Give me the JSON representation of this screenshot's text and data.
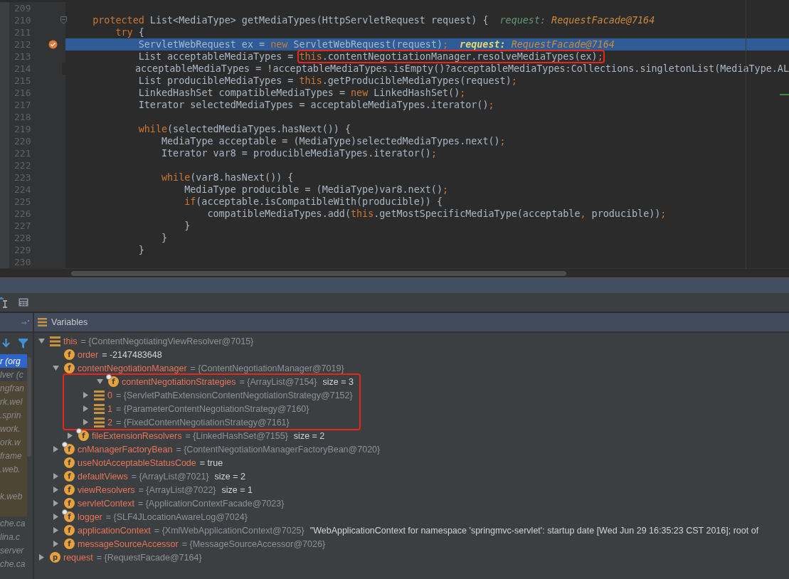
{
  "editor": {
    "lines": [
      {
        "number": "209"
      },
      {
        "number": "210",
        "foldable": true,
        "tokens": [
          {
            "kind": "keyword",
            "text": "protected"
          },
          {
            "kind": "plain",
            "text": " List<MediaType> getMediaTypes(HttpServletRequest request) {"
          }
        ],
        "hint": {
          "label": "request:",
          "value": "RequestFacade@7164"
        },
        "children": [
          {
            "number": "211",
            "tokens": [
              {
                "kind": "keyword",
                "text": "try"
              },
              {
                "kind": "plain",
                "text": " {"
              }
            ],
            "children": [
              {
                "number": "212",
                "selected": true,
                "breakpoint": true,
                "tokens": [
                  {
                    "kind": "plain",
                    "text": "ServletWebRequest ex = "
                  },
                  {
                    "kind": "keyword",
                    "text": "new"
                  },
                  {
                    "kind": "plain",
                    "text": " ServletWebRequest(request)"
                  },
                  {
                    "kind": "punct",
                    "text": ";"
                  }
                ],
                "hint": {
                  "label": "request:",
                  "value": "RequestFacade@7164"
                }
              },
              {
                "number": "213",
                "tokens": [
                  {
                    "kind": "plain",
                    "text": "List acceptableMediaTypes = "
                  },
                  {
                    "kind": "keyword",
                    "text": "this",
                    "boxed": true
                  },
                  {
                    "kind": "plain",
                    "text": ".contentNegotiationManager.resolveMediaTypes(ex)",
                    "boxed": true
                  },
                  {
                    "kind": "punct",
                    "text": ";",
                    "boxed": true
                  }
                ]
              },
              {
                "number": "214",
                "tokens": [
                  {
                    "kind": "plain",
                    "text": "acceptableMediaTypes = !acceptableMediaTypes.isEmpty()?acceptableMediaTypes:Collections.singletonList(MediaType.AL"
                  }
                ]
              },
              {
                "number": "215",
                "tokens": [
                  {
                    "kind": "plain",
                    "text": "List producibleMediaTypes = "
                  },
                  {
                    "kind": "keyword",
                    "text": "this"
                  },
                  {
                    "kind": "plain",
                    "text": ".getProducibleMediaTypes(request)"
                  },
                  {
                    "kind": "punct",
                    "text": ";"
                  }
                ]
              },
              {
                "number": "216",
                "tokens": [
                  {
                    "kind": "plain",
                    "text": "LinkedHashSet compatibleMediaTypes = "
                  },
                  {
                    "kind": "keyword",
                    "text": "new"
                  },
                  {
                    "kind": "plain",
                    "text": " LinkedHashSet()"
                  },
                  {
                    "kind": "punct",
                    "text": ";"
                  }
                ]
              },
              {
                "number": "217",
                "tokens": [
                  {
                    "kind": "plain",
                    "text": "Iterator selectedMediaTypes = acceptableMediaTypes.iterator()"
                  },
                  {
                    "kind": "punct",
                    "text": ";"
                  }
                ]
              },
              {
                "number": "218"
              },
              {
                "number": "219",
                "tokens": [
                  {
                    "kind": "keyword",
                    "text": "while"
                  },
                  {
                    "kind": "plain",
                    "text": "(selectedMediaTypes.hasNext()) {"
                  }
                ],
                "children": [
                  {
                    "number": "220",
                    "tokens": [
                      {
                        "kind": "plain",
                        "text": "MediaType acceptable = (MediaType)selectedMediaTypes.next()"
                      },
                      {
                        "kind": "punct",
                        "text": ";"
                      }
                    ]
                  },
                  {
                    "number": "221",
                    "tokens": [
                      {
                        "kind": "plain",
                        "text": "Iterator var8 = producibleMediaTypes.iterator()"
                      },
                      {
                        "kind": "punct",
                        "text": ";"
                      }
                    ]
                  },
                  {
                    "number": "222"
                  },
                  {
                    "number": "223",
                    "tokens": [
                      {
                        "kind": "keyword",
                        "text": "while"
                      },
                      {
                        "kind": "plain",
                        "text": "(var8.hasNext()) {"
                      }
                    ],
                    "children": [
                      {
                        "number": "224",
                        "tokens": [
                          {
                            "kind": "plain",
                            "text": "MediaType producible = (MediaType)var8.next()"
                          },
                          {
                            "kind": "punct",
                            "text": ";"
                          }
                        ]
                      },
                      {
                        "number": "225",
                        "tokens": [
                          {
                            "kind": "keyword",
                            "text": "if"
                          },
                          {
                            "kind": "plain",
                            "text": "(acceptable.isCompatibleWith(producible)) {"
                          }
                        ],
                        "children": [
                          {
                            "number": "226",
                            "tokens": [
                              {
                                "kind": "plain",
                                "text": "compatibleMediaTypes.add("
                              },
                              {
                                "kind": "keyword",
                                "text": "this"
                              },
                              {
                                "kind": "plain",
                                "text": ".getMostSpecificMediaType(acceptable"
                              },
                              {
                                "kind": "punct",
                                "text": ","
                              },
                              {
                                "kind": "plain",
                                "text": " producible))"
                              },
                              {
                                "kind": "punct",
                                "text": ";"
                              }
                            ]
                          }
                        ]
                      },
                      {
                        "number": "227",
                        "tokens": [
                          {
                            "kind": "plain",
                            "text": "}"
                          }
                        ]
                      }
                    ]
                  },
                  {
                    "number": "228",
                    "tokens": [
                      {
                        "kind": "plain",
                        "text": "}"
                      }
                    ]
                  }
                ]
              },
              {
                "number": "229",
                "tokens": [
                  {
                    "kind": "plain",
                    "text": "}"
                  }
                ]
              },
              {
                "number": "230"
              }
            ]
          }
        ]
      }
    ]
  },
  "frames": {
    "items": [
      {
        "label": "r (org",
        "selected": true,
        "library": false
      },
      {
        "label": "lver (c",
        "selected": false,
        "library": false
      },
      {
        "label": "ngfran",
        "selected": false,
        "library": true
      },
      {
        "label": "rk.wel",
        "selected": false,
        "library": true
      },
      {
        "label": ".sprin",
        "selected": false,
        "library": true
      },
      {
        "label": "work.",
        "selected": false,
        "library": true
      },
      {
        "label": "ork.w",
        "selected": false,
        "library": true
      },
      {
        "label": "frame",
        "selected": false,
        "library": true
      },
      {
        "label": ".web.",
        "selected": false,
        "library": true
      },
      {
        "selected": false,
        "library": true
      },
      {
        "label": "k.web",
        "selected": false,
        "library": true
      },
      {
        "selected": false,
        "library": true
      },
      {
        "label": "che.ca",
        "selected": false,
        "library": false
      },
      {
        "label": "lina.c",
        "selected": false,
        "library": false
      },
      {
        "label": "server",
        "selected": false,
        "library": false
      },
      {
        "label": "che.ca",
        "selected": false,
        "library": false
      }
    ]
  },
  "variables": {
    "title": "Variables",
    "nodes": [
      {
        "name": "this",
        "kind": "object",
        "value": "= {ContentNegotiatingViewResolver@7015}",
        "expanded": true,
        "children": [
          {
            "name": "order",
            "kind": "field",
            "badge": "f",
            "literal": "= -2147483648"
          },
          {
            "name": "contentNegotiationManager",
            "kind": "field",
            "badge": "f",
            "value": "= {ContentNegotiationManager@7019}",
            "expanded": true,
            "children": [
              {
                "name": "contentNegotiationStrategies",
                "kind": "field",
                "badge": "f",
                "marked": true,
                "highlighted": true,
                "value": "= {ArrayList@7154}",
                "extra": "size = 3",
                "expanded": true,
                "children": [
                  {
                    "name": "0",
                    "kind": "object",
                    "value": "= {ServletPathExtensionContentNegotiationStrategy@7152}",
                    "expanded": false
                  },
                  {
                    "name": "1",
                    "kind": "object",
                    "value": "= {ParameterContentNegotiationStrategy@7160}",
                    "expanded": false
                  },
                  {
                    "name": "2",
                    "kind": "object",
                    "value": "= {FixedContentNegotiationStrategy@7161}",
                    "expanded": false
                  }
                ]
              },
              {
                "name": "fileExtensionResolvers",
                "kind": "field",
                "badge": "f",
                "marked": true,
                "value": "= {LinkedHashSet@7155}",
                "extra": "size = 2",
                "expanded": false
              }
            ]
          },
          {
            "name": "cnManagerFactoryBean",
            "kind": "field",
            "badge": "f",
            "marked": true,
            "value": "= {ContentNegotiationManagerFactoryBean@7020}",
            "expanded": false
          },
          {
            "name": "useNotAcceptableStatusCode",
            "kind": "field",
            "badge": "f",
            "literal": "= true"
          },
          {
            "name": "defaultViews",
            "kind": "field",
            "badge": "f",
            "value": "= {ArrayList@7021}",
            "extra": "size = 2",
            "expanded": false
          },
          {
            "name": "viewResolvers",
            "kind": "field",
            "badge": "f",
            "value": "= {ArrayList@7022}",
            "extra": "size = 1",
            "expanded": false
          },
          {
            "name": "servletContext",
            "kind": "field",
            "badge": "f",
            "value": "= {ApplicationContextFacade@7023}",
            "expanded": false
          },
          {
            "name": "logger",
            "kind": "field",
            "badge": "f",
            "marked": true,
            "value": "= {SLF4JLocationAwareLog@7024}",
            "expanded": false
          },
          {
            "name": "applicationContext",
            "kind": "field",
            "badge": "f",
            "value": "= {XmlWebApplicationContext@7025}",
            "extra": "\"WebApplicationContext for namespace 'springmvc-servlet': startup date [Wed Jun 29 16:35:23 CST 2016]; root of",
            "expanded": false
          },
          {
            "name": "messageSourceAccessor",
            "kind": "field",
            "badge": "f",
            "value": "= {MessageSourceAccessor@7026}",
            "expanded": false
          }
        ]
      },
      {
        "name": "request",
        "kind": "param",
        "badge": "p",
        "value": "= {RequestFacade@7164}",
        "expanded": false
      }
    ]
  }
}
